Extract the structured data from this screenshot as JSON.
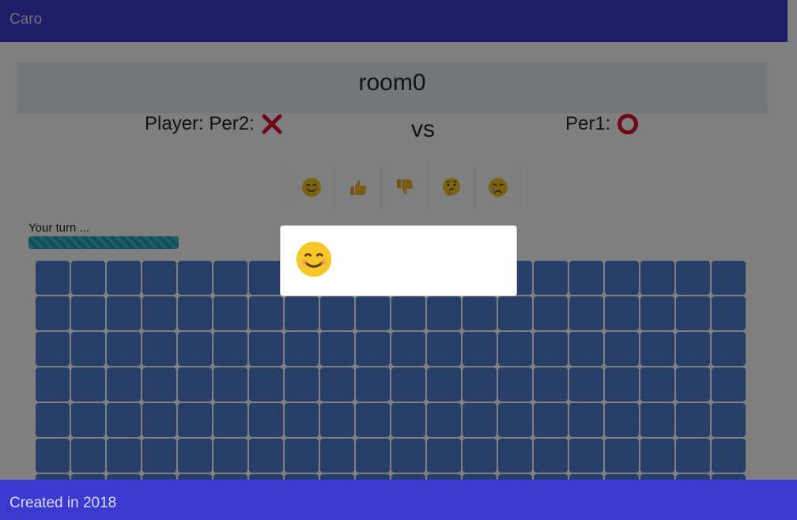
{
  "header": {
    "title": "Caro"
  },
  "room": {
    "name": "room0",
    "player_label": "Player: Per2:",
    "player_mark": "x-mark-icon",
    "vs": "vs",
    "opponent_label": "Per1:",
    "opponent_mark": "o-mark-icon"
  },
  "emojis": [
    {
      "name": "smiling-face-icon"
    },
    {
      "name": "thumbs-up-icon"
    },
    {
      "name": "thumbs-down-icon"
    },
    {
      "name": "thinking-face-icon"
    },
    {
      "name": "crying-face-icon"
    }
  ],
  "turn": {
    "text": "Your turn ...",
    "progress_percent": 100
  },
  "board": {
    "columns": 20,
    "visible_rows": 7
  },
  "popup": {
    "emoji": "smiling-face-icon"
  },
  "footer": {
    "text": "Created in 2018"
  },
  "colors": {
    "header": "#3a3ad0",
    "cell": "#4f7fd0",
    "progress": "#17a2b8",
    "x_mark": "#e0102c",
    "o_mark": "#e0102c"
  }
}
